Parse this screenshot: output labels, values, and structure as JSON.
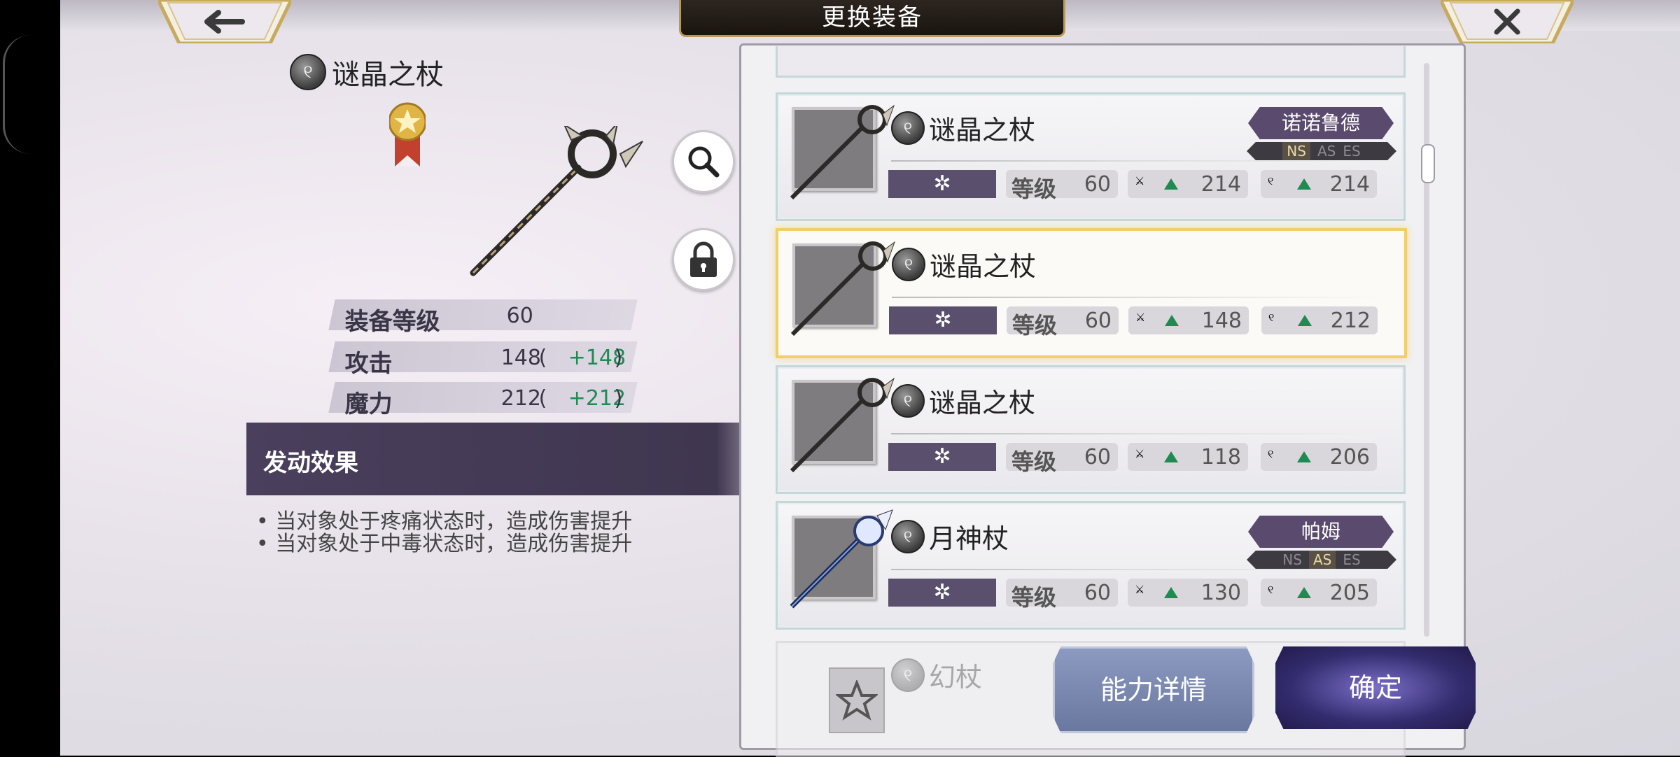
{
  "header": {
    "title": "更换装备",
    "back_icon": "back-arrow-icon",
    "close_icon": "close-x-icon"
  },
  "detail": {
    "name": "谜晶之杖",
    "stats": [
      {
        "label": "装备等级",
        "value": "60",
        "bonus": ""
      },
      {
        "label": "攻击",
        "value": "148",
        "bonus": "+148"
      },
      {
        "label": "魔力",
        "value": "212",
        "bonus": "+212"
      }
    ],
    "effect_title": "发动效果",
    "effects": [
      "当对象处于疼痛状态时，造成伤害提升",
      "当对象处于中毒状态时，造成伤害提升"
    ]
  },
  "list": {
    "level_label": "等级",
    "items": [
      {
        "name": "谜晶之杖",
        "level": "60",
        "atk": "214",
        "mag": "214",
        "owner": "诺诺鲁德",
        "modes": [
          "NS",
          "AS",
          "ES"
        ],
        "active_mode": "NS",
        "selected": false
      },
      {
        "name": "谜晶之杖",
        "level": "60",
        "atk": "148",
        "mag": "212",
        "owner": "",
        "selected": true
      },
      {
        "name": "谜晶之杖",
        "level": "60",
        "atk": "118",
        "mag": "206",
        "owner": "",
        "selected": false
      },
      {
        "name": "月神杖",
        "level": "60",
        "atk": "130",
        "mag": "205",
        "owner": "帕姆",
        "modes": [
          "NS",
          "AS",
          "ES"
        ],
        "active_mode": "AS",
        "selected": false
      }
    ],
    "partial_item": "幻杖"
  },
  "buttons": {
    "detail": "能力详情",
    "confirm": "确定"
  },
  "colors": {
    "accent_green": "#1f8a52",
    "panel_purple": "#4a3f5c",
    "gold": "#c7a45a"
  }
}
